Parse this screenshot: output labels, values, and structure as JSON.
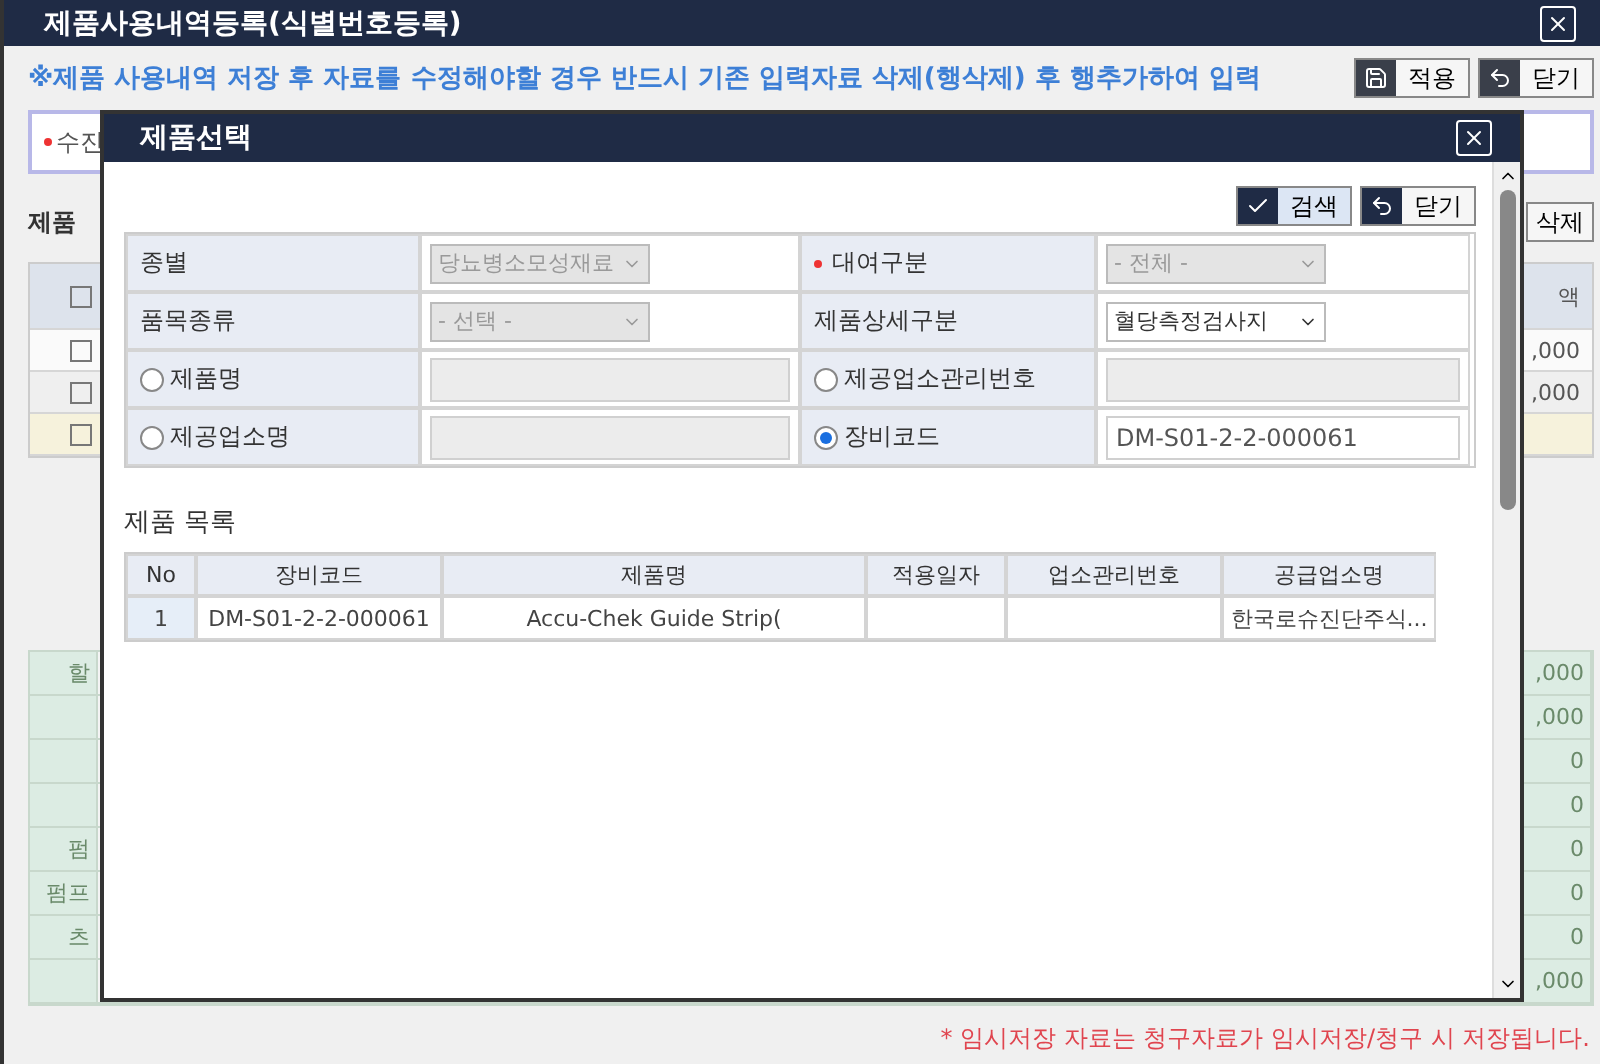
{
  "window": {
    "title": "제품사용내역등록(식별번호등록)"
  },
  "notice": "※제품 사용내역 저장 후 자료를 수정해야할 경우 반드시 기존 입력자료 삭제(행삭제) 후 행추가하여 입력",
  "toolbar": [
    {
      "kind": "save",
      "label": "적용"
    },
    {
      "kind": "back",
      "label": "닫기"
    }
  ],
  "form_field": {
    "label": "수진",
    "required": true
  },
  "section_label": "제품",
  "row_delete_button": "삭제",
  "usage_table": {
    "header_checked": false,
    "header_right": "액",
    "rows": [
      {
        "checked": false,
        "highlighted": false,
        "amount": ",000"
      },
      {
        "checked": false,
        "highlighted": false,
        "amount": ",000"
      },
      {
        "checked": false,
        "highlighted": true
      }
    ]
  },
  "summary_table": {
    "rows": [
      {
        "label": "할",
        "value": ",000"
      },
      {
        "value": ",000"
      },
      {
        "value": "0"
      },
      {
        "value": "0"
      },
      {
        "label": "펌",
        "value": "0"
      },
      {
        "label": "펌프",
        "value": "0"
      },
      {
        "label": "츠",
        "value": "0"
      },
      {
        "value": ",000"
      }
    ]
  },
  "footnote": "* 임시저장 자료는 청구자료가 임시저장/청구 시 저장됩니다.",
  "dialog": {
    "title": "제품선택",
    "buttons": [
      {
        "kind": "search",
        "label": "검색"
      },
      {
        "kind": "back",
        "label": "닫기"
      }
    ],
    "filters": [
      [
        {
          "kind": "select",
          "label": "종별",
          "required": false,
          "value": "당뇨병소모성재료",
          "disabled": true
        },
        {
          "kind": "select",
          "label": "대여구분",
          "required": true,
          "value": "- 전체 -",
          "disabled": true
        }
      ],
      [
        {
          "kind": "select",
          "label": "품목종류",
          "required": false,
          "value": "- 선택 -",
          "disabled": true
        },
        {
          "kind": "select",
          "label": "제품상세구분",
          "required": false,
          "value": "혈당측정검사지",
          "disabled": false
        }
      ],
      [
        {
          "kind": "radio",
          "label": "제품명",
          "required": false,
          "selected": false
        },
        {
          "kind": "radio",
          "label": "제공업소관리번호",
          "required": false,
          "selected": false
        }
      ],
      [
        {
          "kind": "radio",
          "label": "제공업소명",
          "required": false,
          "selected": false
        },
        {
          "kind": "radio",
          "label": "장비코드",
          "required": false,
          "selected": true,
          "value": "DM-S01-2-2-000061"
        }
      ]
    ],
    "list_title": "제품 목록",
    "list": {
      "columns": [
        "No",
        "장비코드",
        "제품명",
        "적용일자",
        "업소관리번호",
        "공급업소명"
      ],
      "rows": [
        {
          "selected": false,
          "no": "1",
          "code": "DM-S01-2-2-000061",
          "name": "Accu-Chek Guide Strip(",
          "supplier": "한국로슈진단주식..."
        }
      ]
    }
  }
}
